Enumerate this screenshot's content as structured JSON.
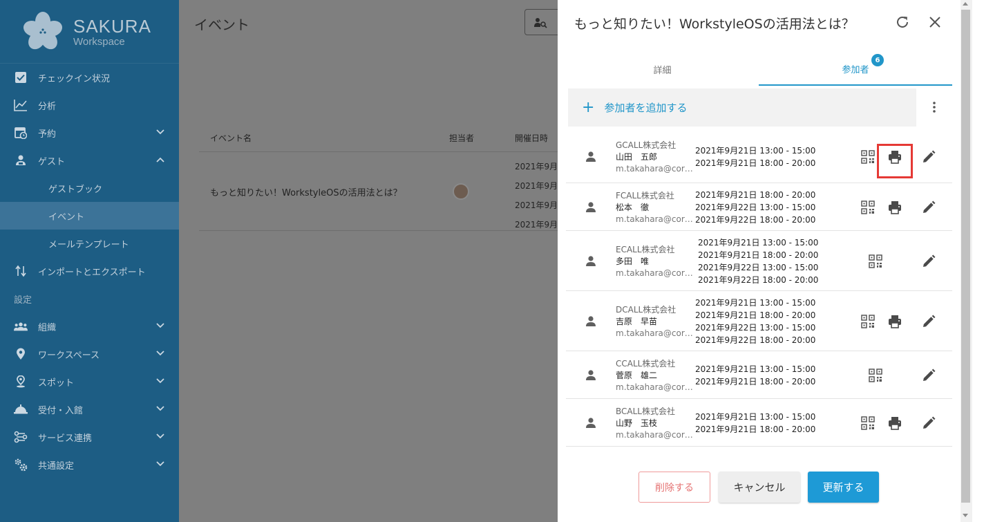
{
  "sidebar": {
    "logo_title": "SAKURA",
    "logo_sub": "Workspace",
    "items": [
      {
        "label": "チェックイン状況",
        "icon": "checkbox-icon"
      },
      {
        "label": "分析",
        "icon": "chart-line-icon"
      },
      {
        "label": "予約",
        "icon": "calendar-clock-icon"
      },
      {
        "label": "ゲスト",
        "icon": "guest-icon"
      }
    ],
    "sub_items": [
      {
        "label": "ゲストブック"
      },
      {
        "label": "イベント"
      },
      {
        "label": "メールテンプレート"
      }
    ],
    "import_export": "インポートとエクスポート",
    "section_settings": "設定",
    "settings_items": [
      {
        "label": "組織",
        "icon": "people-icon"
      },
      {
        "label": "ワークスペース",
        "icon": "map-pin-icon"
      },
      {
        "label": "スポット",
        "icon": "spot-pin-icon"
      },
      {
        "label": "受付・入館",
        "icon": "reception-bell-icon"
      },
      {
        "label": "サービス連携",
        "icon": "integration-icon"
      },
      {
        "label": "共通設定",
        "icon": "gears-icon"
      }
    ]
  },
  "main": {
    "title": "イベント",
    "table": {
      "headers": [
        "イベント名",
        "担当者",
        "開催日時"
      ],
      "row": {
        "name": "もっと知りたい！WorkstyleOSの活用法とは？",
        "dates": [
          "2021年9月",
          "2021年9月",
          "2021年9月",
          "2021年9月"
        ]
      }
    }
  },
  "drawer": {
    "title": "もっと知りたい！WorkstyleOSの活用法とは？",
    "tabs": [
      {
        "label": "詳細"
      },
      {
        "label": "参加者",
        "badge": "6"
      }
    ],
    "add_label": "参加者を追加する",
    "participants": [
      {
        "company": "GCALL株式会社",
        "name": "山田　五郎",
        "email": "m.takahara@corp...",
        "schedules": [
          "2021年9月21日 13:00 - 15:00",
          "2021年9月21日 18:00 - 20:00"
        ],
        "printable": true
      },
      {
        "company": "FCALL株式会社",
        "name": "松本　徹",
        "email": "m.takahara@corp...",
        "schedules": [
          "2021年9月21日 18:00 - 20:00",
          "2021年9月22日 13:00 - 15:00",
          "2021年9月22日 18:00 - 20:00"
        ],
        "printable": true
      },
      {
        "company": "ECALL株式会社",
        "name": "多田　唯",
        "email": "m.takahara@corp...",
        "schedules": [
          "2021年9月21日 13:00 - 15:00",
          "2021年9月21日 18:00 - 20:00",
          "2021年9月22日 13:00 - 15:00",
          "2021年9月22日 18:00 - 20:00"
        ],
        "printable": false
      },
      {
        "company": "DCALL株式会社",
        "name": "吉原　早苗",
        "email": "m.takahara@corp...",
        "schedules": [
          "2021年9月21日 13:00 - 15:00",
          "2021年9月21日 18:00 - 20:00",
          "2021年9月22日 13:00 - 15:00",
          "2021年9月22日 18:00 - 20:00"
        ],
        "printable": true
      },
      {
        "company": "CCALL株式会社",
        "name": "菅原　雄二",
        "email": "m.takahara@corp...",
        "schedules": [
          "2021年9月21日 13:00 - 15:00",
          "2021年9月21日 18:00 - 20:00"
        ],
        "printable": false
      },
      {
        "company": "BCALL株式会社",
        "name": "山野　玉枝",
        "email": "m.takahara@corp...",
        "schedules": [
          "2021年9月21日 13:00 - 15:00",
          "2021年9月21日 18:00 - 20:00"
        ],
        "printable": true
      }
    ],
    "buttons": {
      "delete": "削除する",
      "cancel": "キャンセル",
      "update": "更新する"
    }
  },
  "colors": {
    "sidebar_bg": "#1d5d84",
    "accent": "#2196c9",
    "update_btn": "#1e9ad6",
    "delete_text": "#e57373",
    "highlight": "#e53935"
  }
}
